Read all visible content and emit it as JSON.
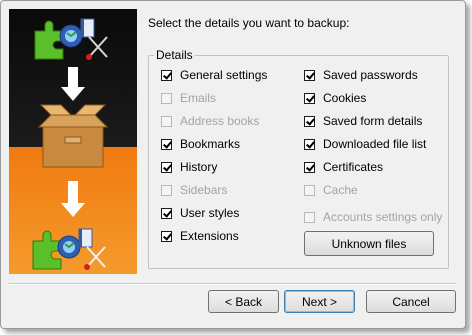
{
  "heading": "Select the details you want to backup:",
  "details_legend": "Details",
  "left_options": [
    {
      "label": "General settings",
      "checked": true,
      "enabled": true
    },
    {
      "label": "Emails",
      "checked": false,
      "enabled": false
    },
    {
      "label": "Address books",
      "checked": false,
      "enabled": false
    },
    {
      "label": "Bookmarks",
      "checked": true,
      "enabled": true
    },
    {
      "label": "History",
      "checked": true,
      "enabled": true
    },
    {
      "label": "Sidebars",
      "checked": false,
      "enabled": false
    },
    {
      "label": "User styles",
      "checked": true,
      "enabled": true
    },
    {
      "label": "Extensions",
      "checked": true,
      "enabled": true
    }
  ],
  "right_options": [
    {
      "label": "Saved passwords",
      "checked": true,
      "enabled": true
    },
    {
      "label": "Cookies",
      "checked": true,
      "enabled": true
    },
    {
      "label": "Saved form details",
      "checked": true,
      "enabled": true
    },
    {
      "label": "Downloaded file list",
      "checked": true,
      "enabled": true
    },
    {
      "label": "Certificates",
      "checked": true,
      "enabled": true
    },
    {
      "label": "Cache",
      "checked": false,
      "enabled": false
    },
    {
      "label": "Accounts settings only",
      "checked": false,
      "enabled": false
    }
  ],
  "unknown_files_button": "Unknown files",
  "buttons": {
    "back": "< Back",
    "next": "Next >",
    "cancel": "Cancel"
  },
  "colors": {
    "banner_top": "#0a0a0a",
    "banner_bottom": "#f07a10",
    "accent_button_border": "#3c7fb1"
  }
}
